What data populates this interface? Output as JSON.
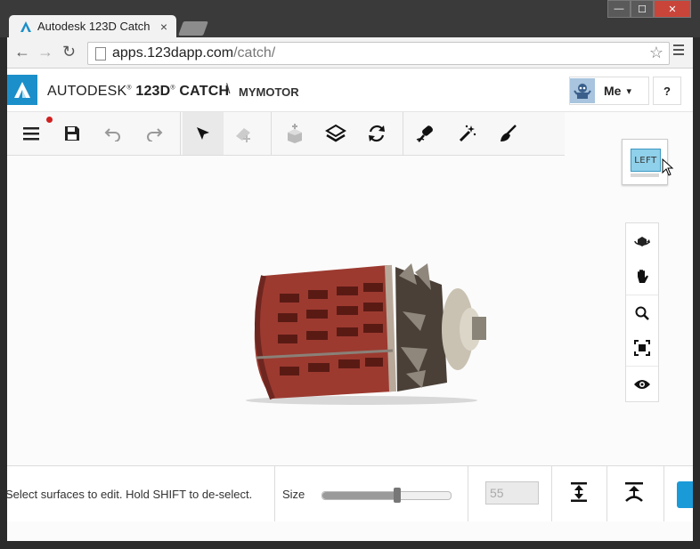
{
  "browser": {
    "tab_title": "Autodesk 123D Catch",
    "tab_close": "×",
    "url_host": "apps.123dapp.com",
    "url_path": "/catch/",
    "window_buttons": {
      "minimize": "—",
      "maximize": "☐",
      "close": "✕"
    }
  },
  "header": {
    "brand_prefix": "AUTODESK",
    "brand_product": "123D",
    "brand_suffix": "CATCH",
    "separator": "\\",
    "project_name": "MYMOTOR",
    "user_menu_label": "Me",
    "help_label": "?"
  },
  "toolbar": {
    "tools": [
      "menu-icon",
      "save-icon",
      "undo-icon",
      "redo-icon",
      "select-icon",
      "eraser-icon",
      "add-object-icon",
      "layers-icon",
      "rotate-icon",
      "marker-icon",
      "magic-wand-icon",
      "paint-brush-icon"
    ],
    "unsaved_indicator": true
  },
  "view_cube": {
    "face_label": "LEFT"
  },
  "nav_panel": {
    "tools": [
      "orbit-icon",
      "pan-icon",
      "zoom-icon",
      "fit-icon",
      "look-icon"
    ]
  },
  "bottom_bar": {
    "hint": "Select surfaces to edit. Hold SHIFT to de-select.",
    "size_label": "Size",
    "size_value": "55",
    "slider_fraction": 0.58,
    "actions": [
      "extrude-up-icon",
      "extrude-out-icon"
    ]
  },
  "colors": {
    "accent": "#1b8fc9",
    "button_blue": "#1b9ad8",
    "model_red": "#9c3a30"
  }
}
